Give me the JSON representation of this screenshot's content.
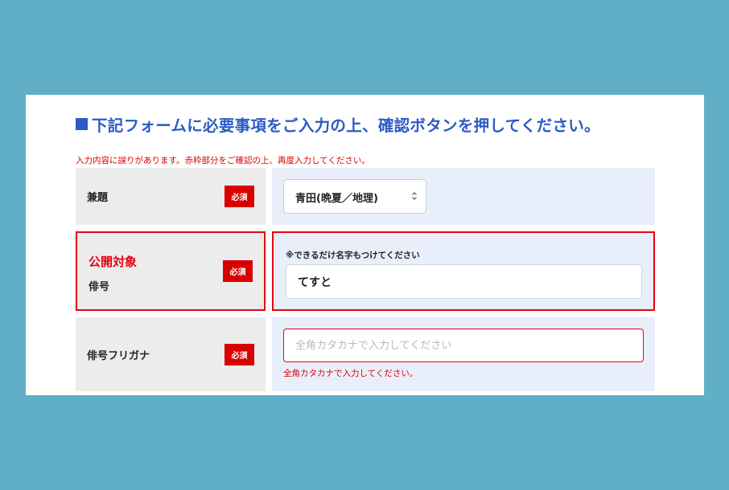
{
  "heading": {
    "icon": "blue-square-icon",
    "text": "下記フォームに必要事項をご入力の上、確認ボタンを押してください。"
  },
  "error_banner": "入力内容に誤りがあります。赤枠部分をご確認の上、再度入力してください。",
  "required_badge": "必須",
  "fields": {
    "title": {
      "label": "兼題",
      "select_value": "青田(晩夏／地理)"
    },
    "haigou": {
      "public_label": "公開対象",
      "label": "俳号",
      "hint": "※できるだけ名字もつけてください",
      "value": "てすと"
    },
    "furigana": {
      "label": "俳号フリガナ",
      "value": "",
      "placeholder": "全角カタカナで入力してください",
      "error": "全角カタカナで入力してください。"
    }
  },
  "colors": {
    "background": "#61afc6",
    "heading": "#2c5ac6",
    "error": "#e60012",
    "required_badge": "#d90000",
    "label_cell": "#ececec",
    "input_cell": "#e9eefb"
  }
}
